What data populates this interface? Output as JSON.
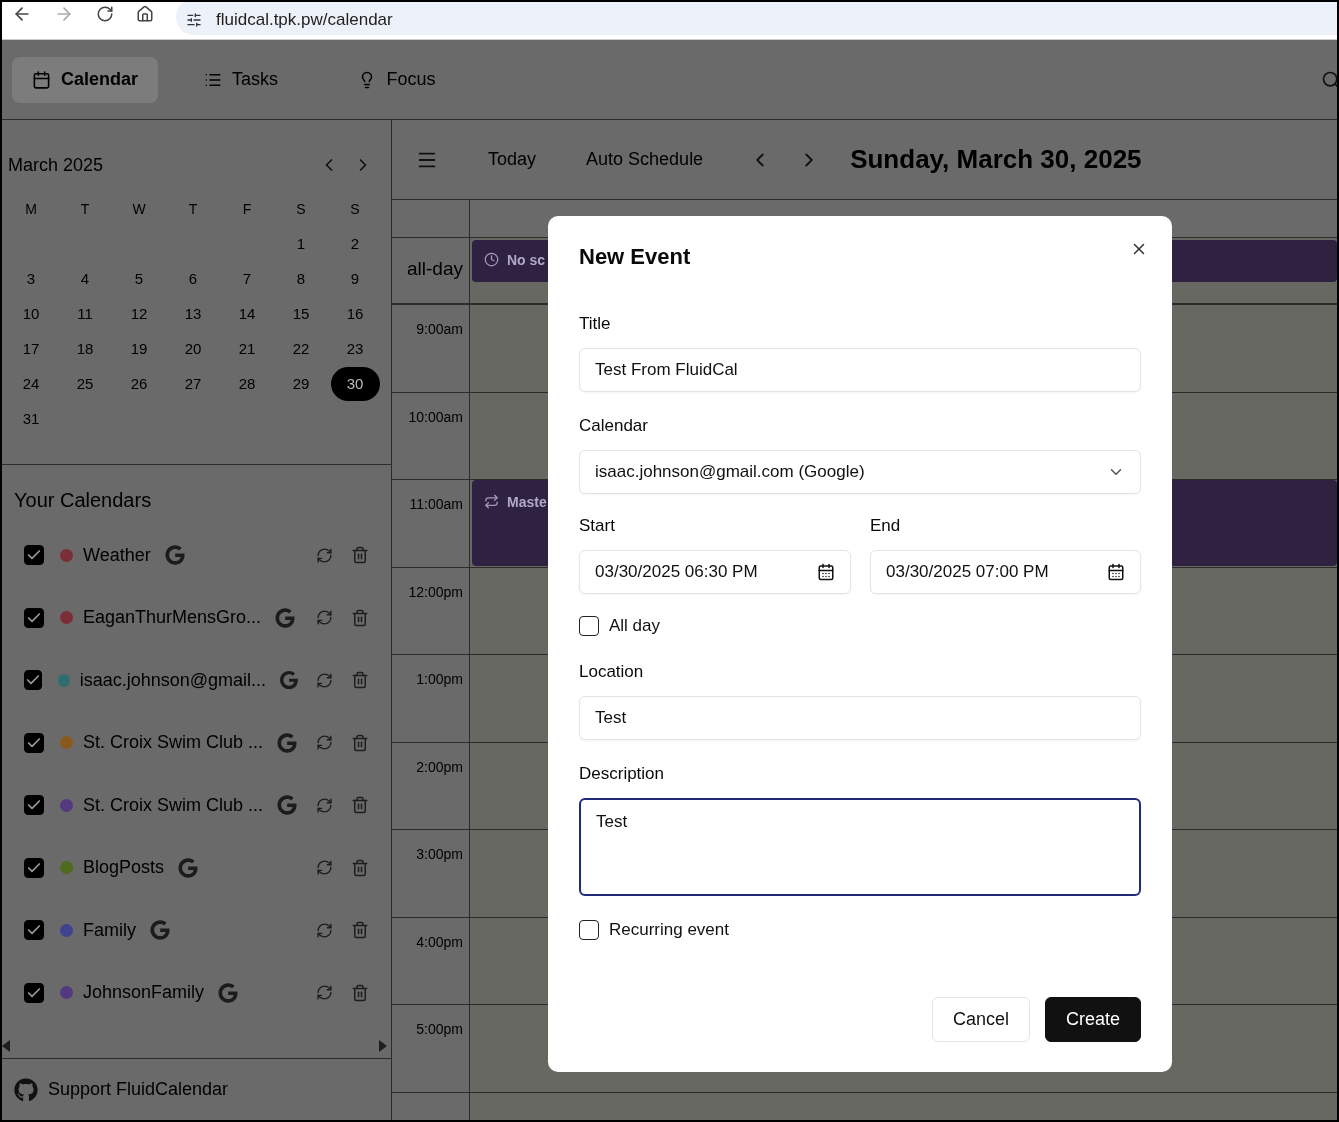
{
  "browser": {
    "url": "fluidcal.tpk.pw/calendar"
  },
  "nav": {
    "tabs": [
      {
        "label": "Calendar",
        "selected": true
      },
      {
        "label": "Tasks",
        "selected": false
      },
      {
        "label": "Focus",
        "selected": false
      }
    ]
  },
  "mini_calendar": {
    "month": "March 2025",
    "weekdays": [
      "M",
      "T",
      "W",
      "T",
      "F",
      "S",
      "S"
    ],
    "weeks": [
      {
        "days": [
          {
            "label": "1",
            "selected": false
          },
          {
            "label": "2",
            "selected": false
          }
        ]
      },
      {
        "days": [
          {
            "label": "3",
            "selected": false
          },
          {
            "label": "4",
            "selected": false
          },
          {
            "label": "5",
            "selected": false
          },
          {
            "label": "6",
            "selected": false
          },
          {
            "label": "7",
            "selected": false
          },
          {
            "label": "8",
            "selected": false
          },
          {
            "label": "9",
            "selected": false
          }
        ]
      },
      {
        "days": [
          {
            "label": "10",
            "selected": false
          },
          {
            "label": "11",
            "selected": false
          },
          {
            "label": "12",
            "selected": false
          },
          {
            "label": "13",
            "selected": false
          },
          {
            "label": "14",
            "selected": false
          },
          {
            "label": "15",
            "selected": false
          },
          {
            "label": "16",
            "selected": false
          }
        ]
      },
      {
        "days": [
          {
            "label": "17",
            "selected": false
          },
          {
            "label": "18",
            "selected": false
          },
          {
            "label": "19",
            "selected": false
          },
          {
            "label": "20",
            "selected": false
          },
          {
            "label": "21",
            "selected": false
          },
          {
            "label": "22",
            "selected": false
          },
          {
            "label": "23",
            "selected": false
          }
        ]
      },
      {
        "days": [
          {
            "label": "24",
            "selected": false
          },
          {
            "label": "25",
            "selected": false
          },
          {
            "label": "26",
            "selected": false
          },
          {
            "label": "27",
            "selected": false
          },
          {
            "label": "28",
            "selected": false
          },
          {
            "label": "29",
            "selected": false
          },
          {
            "label": "30",
            "selected": true
          }
        ]
      },
      {
        "days": [
          {
            "label": "31",
            "selected": false
          }
        ]
      }
    ]
  },
  "calendars": {
    "heading": "Your Calendars",
    "items": [
      {
        "name": "Weather",
        "color": "#7a2f36",
        "checked": true
      },
      {
        "name": "EaganThurMensGro...",
        "color": "#7a2f36",
        "checked": true
      },
      {
        "name": "isaac.johnson@gmail...",
        "color": "#2f6e6e",
        "checked": true
      },
      {
        "name": "St. Croix Swim Club ...",
        "color": "#8a5a1c",
        "checked": true
      },
      {
        "name": "St. Croix Swim Club ...",
        "color": "#533a80",
        "checked": true
      },
      {
        "name": "BlogPosts",
        "color": "#4f6a1c",
        "checked": true
      },
      {
        "name": "Family",
        "color": "#3f4390",
        "checked": true
      },
      {
        "name": "JohnsonFamily",
        "color": "#533a80",
        "checked": true
      }
    ]
  },
  "support": {
    "label": "Support FluidCalendar"
  },
  "toolbar": {
    "today": "Today",
    "auto_schedule": "Auto Schedule",
    "date_title": "Sunday, March 30, 2025"
  },
  "day_view": {
    "all_day_label": "all-day",
    "all_day_event": {
      "title": "No sc"
    },
    "hours": [
      {
        "label": "9:00am"
      },
      {
        "label": "10:00am"
      },
      {
        "label": "11:00am",
        "event": "Maste"
      },
      {
        "label": "12:00pm"
      },
      {
        "label": "1:00pm"
      },
      {
        "label": "2:00pm"
      },
      {
        "label": "3:00pm"
      },
      {
        "label": "4:00pm"
      },
      {
        "label": "5:00pm"
      }
    ]
  },
  "modal": {
    "title": "New Event",
    "title_field": {
      "label": "Title",
      "value": "Test From FluidCal"
    },
    "calendar_field": {
      "label": "Calendar",
      "value": "isaac.johnson@gmail.com (Google)"
    },
    "start": {
      "label": "Start",
      "value": "03/30/2025 06:30 PM"
    },
    "end": {
      "label": "End",
      "value": "03/30/2025 07:00 PM"
    },
    "all_day": {
      "label": "All day",
      "checked": false
    },
    "location": {
      "label": "Location",
      "value": "Test"
    },
    "description": {
      "label": "Description",
      "value": "Test",
      "focused": true
    },
    "recurring": {
      "label": "Recurring event",
      "checked": false
    },
    "buttons": {
      "cancel": "Cancel",
      "create": "Create"
    }
  }
}
